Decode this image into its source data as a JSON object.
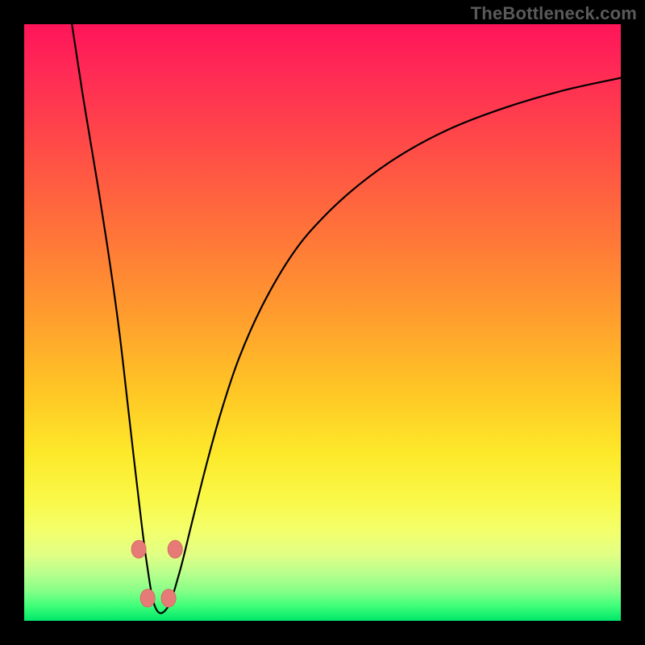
{
  "watermark": {
    "text": "TheBottleneck.com"
  },
  "colors": {
    "background": "#000000",
    "curve_stroke": "#000000",
    "marker_fill": "#e67a77",
    "marker_stroke": "#d96a66"
  },
  "chart_data": {
    "type": "line",
    "title": "",
    "xlabel": "",
    "ylabel": "",
    "xlim": [
      0,
      100
    ],
    "ylim": [
      0,
      100
    ],
    "grid": false,
    "legend": false,
    "notes": "Axes unlabeled; values are percentages of plot width/height (origin bottom-left). Curve is a V-shaped bottleneck profile with minimum near x≈23, rising asymmetrically with a concave-down right arm. Background is a vertical heat gradient (top=red=worst, bottom=green=best). Four salmon-pink markers highlight the sides and bottom of the trough.",
    "series": [
      {
        "name": "bottleneck-curve",
        "x": [
          8.0,
          10.0,
          12.5,
          14.5,
          16.0,
          17.5,
          19.0,
          20.5,
          22.0,
          24.0,
          26.0,
          28.0,
          30.5,
          33.0,
          36.0,
          40.0,
          45.0,
          50.0,
          56.0,
          63.0,
          71.0,
          80.0,
          90.0,
          100.0
        ],
        "y": [
          100.0,
          87.0,
          72.0,
          59.0,
          48.0,
          35.0,
          22.0,
          10.0,
          2.2,
          2.2,
          8.0,
          16.0,
          26.0,
          35.0,
          44.0,
          53.0,
          61.5,
          67.5,
          73.0,
          78.0,
          82.3,
          85.8,
          88.8,
          91.0
        ]
      }
    ],
    "markers": [
      {
        "x": 19.2,
        "y": 12.0
      },
      {
        "x": 25.3,
        "y": 12.0
      },
      {
        "x": 20.7,
        "y": 3.8
      },
      {
        "x": 24.2,
        "y": 3.8
      }
    ]
  }
}
